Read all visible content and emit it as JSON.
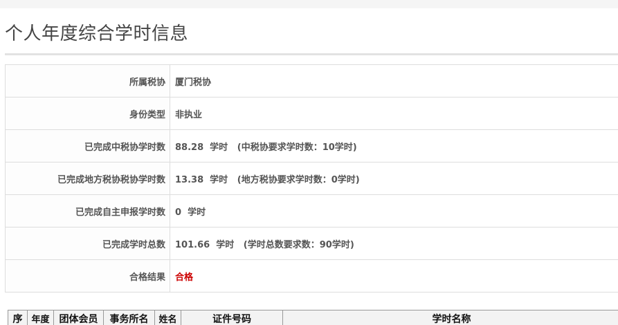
{
  "page": {
    "title": "个人年度综合学时信息"
  },
  "info_rows": [
    {
      "label": "所属税协",
      "value": "厦门税协"
    },
    {
      "label": "身份类型",
      "value": "非执业"
    },
    {
      "label": "已完成中税协学时数",
      "value": "88.28  学时   (中税协要求学时数：10学时)"
    },
    {
      "label": "已完成地方税协税协学时数",
      "value": "13.38  学时   (地方税协要求学时数：0学时)"
    },
    {
      "label": "已完成自主申报学时数",
      "value": "0  学时"
    },
    {
      "label": "已完成学时总数",
      "value": "101.66  学时   (学时总数要求数：90学时)"
    },
    {
      "label": "合格结果",
      "value": "合格"
    }
  ],
  "detail_table": {
    "headers": [
      "序",
      "年度",
      "团体会员",
      "事务所名",
      "姓名",
      "证件号码",
      "学时名称"
    ]
  },
  "colors": {
    "pass": "#cc0000",
    "border": "#dddddd"
  }
}
